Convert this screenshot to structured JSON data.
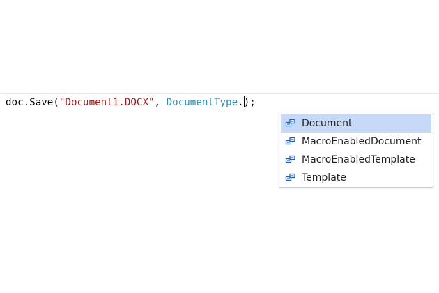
{
  "code": {
    "method_call": "doc.Save(",
    "string_arg": "\"Document1.DOCX\"",
    "separator": ", ",
    "type_name": "DocumentType",
    "dot": ".",
    "closing": ");"
  },
  "completion": {
    "selected_index": 0,
    "items": [
      {
        "label": "Document",
        "icon": "enum-member-icon"
      },
      {
        "label": "MacroEnabledDocument",
        "icon": "enum-member-icon"
      },
      {
        "label": "MacroEnabledTemplate",
        "icon": "enum-member-icon"
      },
      {
        "label": "Template",
        "icon": "enum-member-icon"
      }
    ]
  },
  "colors": {
    "string": "#a31515",
    "type": "#2b91af",
    "selection": "#c6d9f8",
    "icon": "#1f5fb4"
  }
}
